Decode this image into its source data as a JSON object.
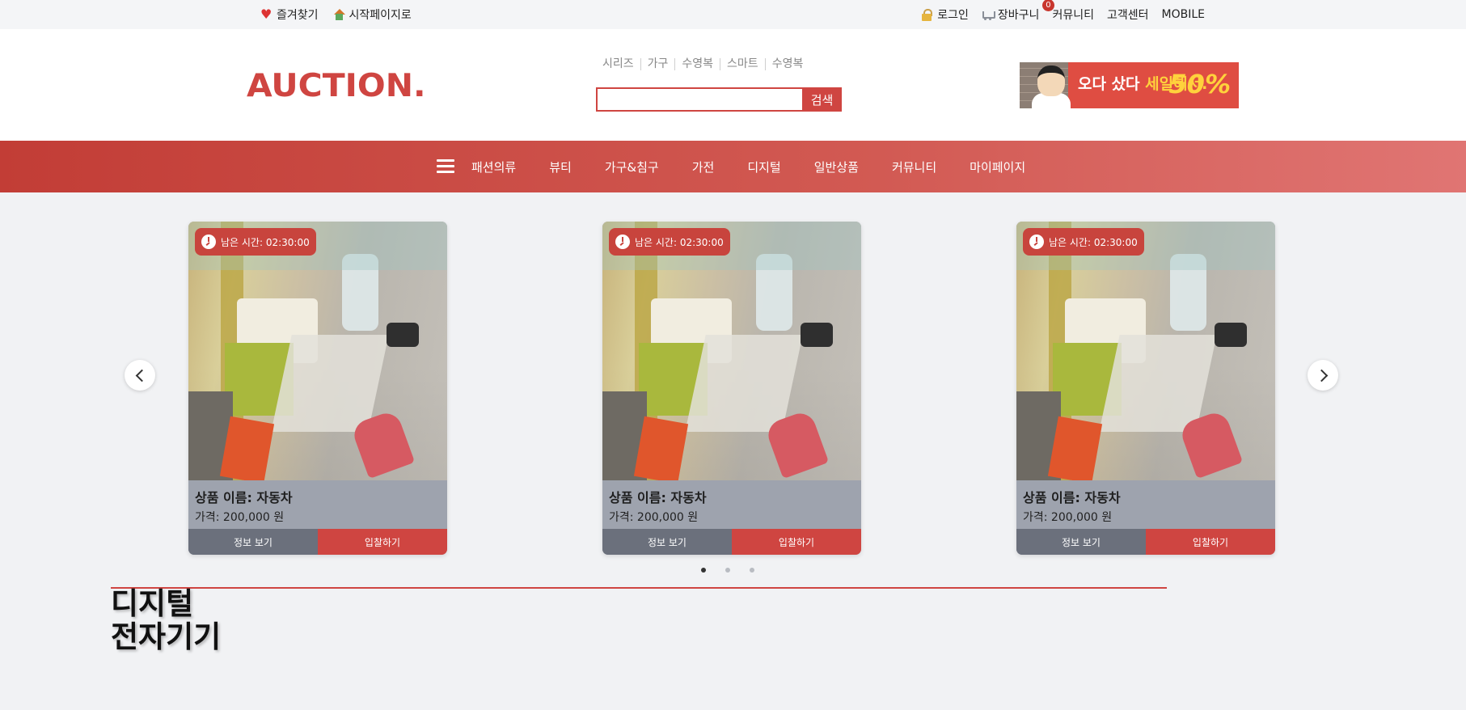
{
  "topbar": {
    "favorites": "즐겨찾기",
    "startpage": "시작페이지로",
    "login": "로그인",
    "cart": "장바구니",
    "cart_count": "0",
    "community": "커뮤니티",
    "support": "고객센터",
    "mobile": "MOBILE"
  },
  "header": {
    "logo": "AUCTION.",
    "keywords": [
      "시리즈",
      "가구",
      "수영복",
      "스마트",
      "수영복"
    ],
    "search": {
      "value": "",
      "button": "검색"
    },
    "banner": {
      "headline": "오다 샀다",
      "headline_accent": "세일해서.",
      "percent": "50%"
    }
  },
  "nav": {
    "items": [
      "패션의류",
      "뷰티",
      "가구&침구",
      "가전",
      "디지털",
      "일반상품",
      "커뮤니티",
      "마이페이지"
    ]
  },
  "carousel": {
    "cards": [
      {
        "timer": "남은 시간: 02:30:00",
        "name": "상품 이름: 자동차",
        "price": "가격: 200,000 원",
        "info_button": "정보 보기",
        "bid_button": "입찰하기"
      },
      {
        "timer": "남은 시간: 02:30:00",
        "name": "상품 이름: 자동차",
        "price": "가격: 200,000 원",
        "info_button": "정보 보기",
        "bid_button": "입찰하기"
      },
      {
        "timer": "남은 시간: 02:30:00",
        "name": "상품 이름: 자동차",
        "price": "가격: 200,000 원",
        "info_button": "정보 보기",
        "bid_button": "입찰하기"
      }
    ],
    "dot_count": 3,
    "active_dot": 0
  },
  "section": {
    "title_line1": "디지털",
    "title_line2": "전자기기"
  },
  "colors": {
    "accent": "#cf4541",
    "nav_start": "#c23d36",
    "nav_end": "#e07573",
    "card_body": "#9ea3ae",
    "info_button": "#6b707c"
  }
}
